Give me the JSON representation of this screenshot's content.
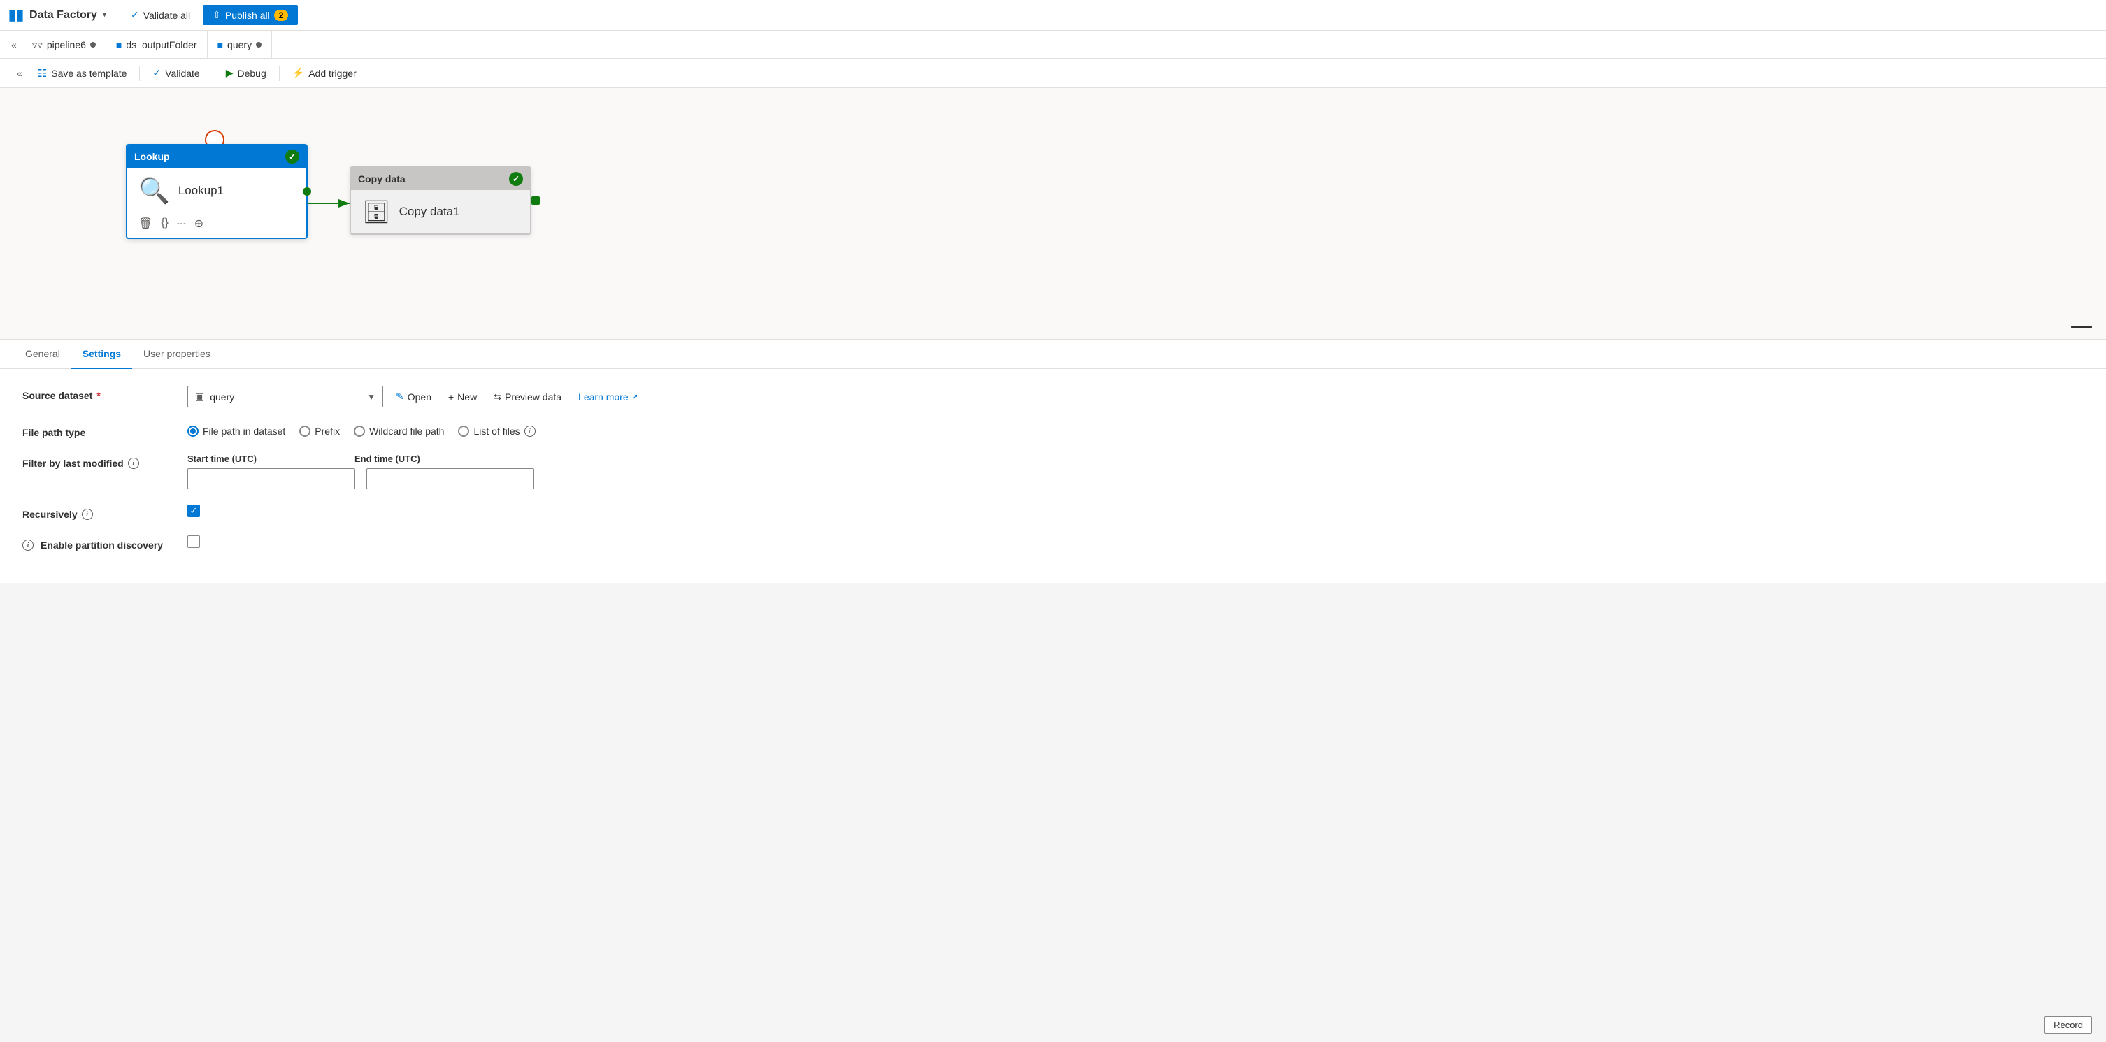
{
  "topbar": {
    "brand": "Data Factory",
    "chevron": "▾",
    "validate_all": "Validate all",
    "publish_all": "Publish all",
    "publish_badge": "2"
  },
  "tabs": [
    {
      "id": "pipeline6",
      "label": "pipeline6",
      "icon": "pipeline",
      "dot": true,
      "active": false
    },
    {
      "id": "ds_outputFolder",
      "label": "ds_outputFolder",
      "icon": "table",
      "dot": false,
      "active": false
    },
    {
      "id": "query",
      "label": "query",
      "icon": "table",
      "dot": true,
      "active": false
    }
  ],
  "toolbar": {
    "save_as_template": "Save as template",
    "validate": "Validate",
    "debug": "Debug",
    "add_trigger": "Add trigger"
  },
  "canvas": {
    "lookup_node": {
      "title": "Lookup",
      "label": "Lookup1"
    },
    "copy_node": {
      "title": "Copy data",
      "label": "Copy data1"
    }
  },
  "settings_panel": {
    "tabs": [
      "General",
      "Settings",
      "User properties"
    ],
    "active_tab": "Settings",
    "source_dataset_label": "Source dataset",
    "source_dataset_value": "query",
    "open_label": "Open",
    "new_label": "New",
    "preview_label": "Preview data",
    "learn_more_label": "Learn more",
    "file_path_type_label": "File path type",
    "radio_options": [
      {
        "id": "filepath_dataset",
        "label": "File path in dataset",
        "checked": true
      },
      {
        "id": "prefix",
        "label": "Prefix",
        "checked": false
      },
      {
        "id": "wildcard",
        "label": "Wildcard file path",
        "checked": false
      },
      {
        "id": "list_files",
        "label": "List of files",
        "checked": false
      }
    ],
    "filter_label": "Filter by last modified",
    "start_time_label": "Start time (UTC)",
    "end_time_label": "End time (UTC)",
    "start_time_value": "",
    "end_time_value": "",
    "recursively_label": "Recursively",
    "recursively_checked": true,
    "partition_label": "Enable partition discovery",
    "partition_checked": false,
    "record_label": "Record"
  }
}
